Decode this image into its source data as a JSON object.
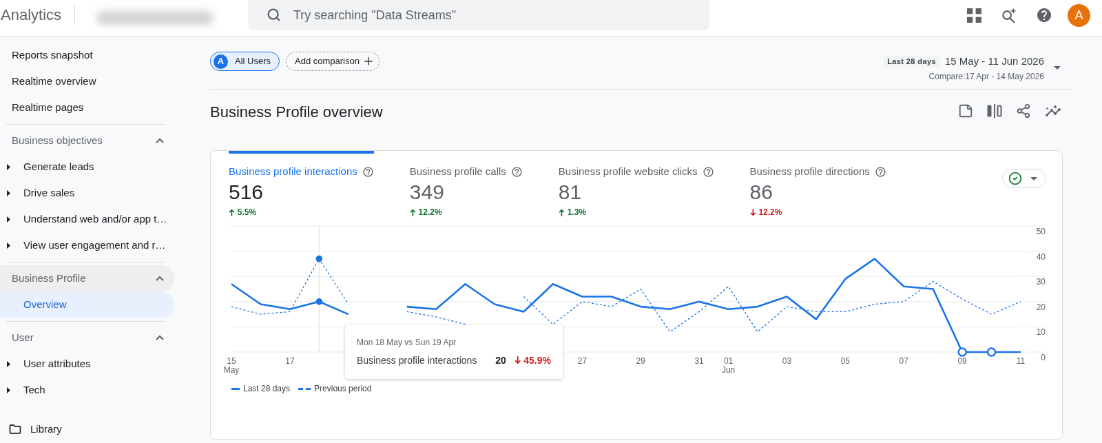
{
  "header": {
    "app_name": "Analytics",
    "search": {
      "placeholder": "Try searching \"Data Streams\""
    },
    "avatar": {
      "initial": "A"
    }
  },
  "sidebar": {
    "items": [
      {
        "label": "Reports snapshot",
        "selected": false
      },
      {
        "label": "Realtime overview",
        "selected": false
      },
      {
        "label": "Realtime pages",
        "selected": false
      }
    ],
    "sections": [
      {
        "title": "Business objectives",
        "expanded": true,
        "highlighted": false,
        "children": [
          {
            "label": "Generate leads",
            "kind": "group",
            "expanded": false,
            "selected": false
          },
          {
            "label": "Drive sales",
            "kind": "group",
            "expanded": false,
            "selected": false
          },
          {
            "label": "Understand web and/or app t…",
            "kind": "group",
            "expanded": false,
            "selected": false
          },
          {
            "label": "View user engagement and r…",
            "kind": "group",
            "expanded": false,
            "selected": false
          }
        ]
      },
      {
        "title": "Business Profile",
        "expanded": true,
        "highlighted": true,
        "children": [
          {
            "label": "Overview",
            "kind": "page",
            "selected": true
          }
        ]
      },
      {
        "title": "User",
        "expanded": true,
        "highlighted": false,
        "children": [
          {
            "label": "User attributes",
            "kind": "group",
            "expanded": false,
            "selected": false
          },
          {
            "label": "Tech",
            "kind": "group",
            "expanded": false,
            "selected": false
          }
        ]
      }
    ],
    "library": {
      "label": "Library"
    }
  },
  "toolbar": {
    "segments": [
      {
        "label": "All Users",
        "badge": "A",
        "kind": "segment"
      },
      {
        "label": "Add comparison",
        "kind": "add"
      }
    ],
    "date_range": {
      "preset": "Last 28 days",
      "range": "15 May - 11 Jun 2026",
      "compare": "Compare:17 Apr - 14 May 2026"
    }
  },
  "page_title": "Business Profile overview",
  "card": {
    "metrics": [
      {
        "label": "Business profile interactions",
        "value": "516",
        "change": "5.5%",
        "increase": true,
        "selected": true
      },
      {
        "label": "Business profile calls",
        "value": "349",
        "change": "12.2%",
        "increase": true,
        "selected": false
      },
      {
        "label": "Business profile website clicks",
        "value": "81",
        "change": "1.3%",
        "increase": true,
        "selected": false
      },
      {
        "label": "Business profile directions",
        "value": "86",
        "change": "12.2%",
        "increase": false,
        "selected": false
      }
    ],
    "chart": {
      "chart_data": {
        "type": "line",
        "categories": [
          "15 May",
          null,
          "17",
          null,
          null,
          null,
          null,
          null,
          null,
          null,
          null,
          null,
          "27",
          null,
          "29",
          null,
          "31",
          "01 Jun",
          null,
          "03",
          null,
          "05",
          null,
          "07",
          null,
          "09",
          null,
          "11"
        ],
        "series": [
          {
            "name": "Last 28 days",
            "color": "#1a73e8",
            "line_style": "solid",
            "values": [
              27,
              19,
              17,
              20,
              15,
              null,
              18,
              17,
              27,
              19,
              16,
              27,
              22,
              22,
              18,
              17,
              20,
              17,
              18,
              22,
              13,
              29,
              37,
              26,
              25,
              0,
              0,
              0
            ]
          },
          {
            "name": "Previous period",
            "color": "#1a73e8",
            "line_style": "dashed",
            "values": [
              18,
              15,
              16,
              37,
              19,
              null,
              16,
              14,
              11,
              null,
              22,
              11,
              20,
              18,
              25,
              8,
              16,
              26,
              8,
              18,
              16,
              16,
              19,
              20,
              28,
              21,
              15,
              20
            ]
          }
        ],
        "ylim": [
          0,
          50
        ],
        "yticks": [
          0,
          10,
          20,
          30,
          40,
          50
        ],
        "grid": true,
        "legend": "bottom"
      },
      "tooltip": {
        "title": "Mon 18 May vs Sun 19 Apr",
        "metric": "Business profile interactions",
        "value": "20",
        "change": "45.9%",
        "increase": false
      }
    }
  }
}
